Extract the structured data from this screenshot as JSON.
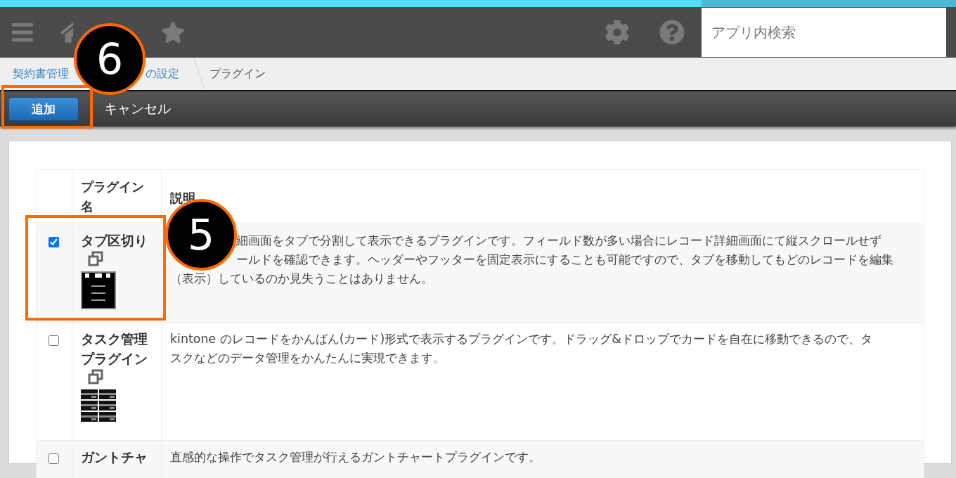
{
  "header": {
    "search": {
      "placeholder": "アプリ内検索"
    }
  },
  "breadcrumb": [
    {
      "label": "契約書管理",
      "current": false
    },
    {
      "label": "の設定",
      "current": false
    },
    {
      "label": "プラグイン",
      "current": true
    }
  ],
  "toolbar": {
    "buttons": [
      {
        "label": "追加",
        "kind": "primary"
      },
      {
        "label": "キャンセル",
        "kind": "plain"
      }
    ]
  },
  "table": {
    "columns": [
      "プラグイン名",
      "説明"
    ],
    "rows": [
      {
        "checked": true,
        "name": "タブ区切り",
        "kind": "tabs",
        "description": [
          {
            "after": "細画面をタブで分割して表示できるプラグインです。フィールド数が多い場合にレコード詳細画面にて縦スクロールせず"
          },
          {
            "after": "ールドを確認できます。ヘッダーやフッターを固定表示にすることも可能ですので、タブを移動してもどのレコードを編集"
          },
          {
            "text": "（表示）しているのか見失うことはありません。"
          }
        ]
      },
      {
        "checked": false,
        "name": "タスク管理プラグイン",
        "kind": "kanban",
        "description": [
          {
            "text": "kintone のレコードをかんばん(カード)形式で表示するプラグインです。ドラッグ&ドロップでカードを自在に移動できるので、タ"
          },
          {
            "text": "スクなどのデータ管理をかんたんに実現できます。"
          }
        ]
      },
      {
        "checked": false,
        "name": "ガントチャ",
        "kind": "plain",
        "description": [
          {
            "text": "直感的な操作でタスク管理が行えるガントチャートプラグインです。"
          }
        ]
      }
    ]
  },
  "callouts": [
    {
      "label": "6"
    },
    {
      "label": "5"
    }
  ]
}
